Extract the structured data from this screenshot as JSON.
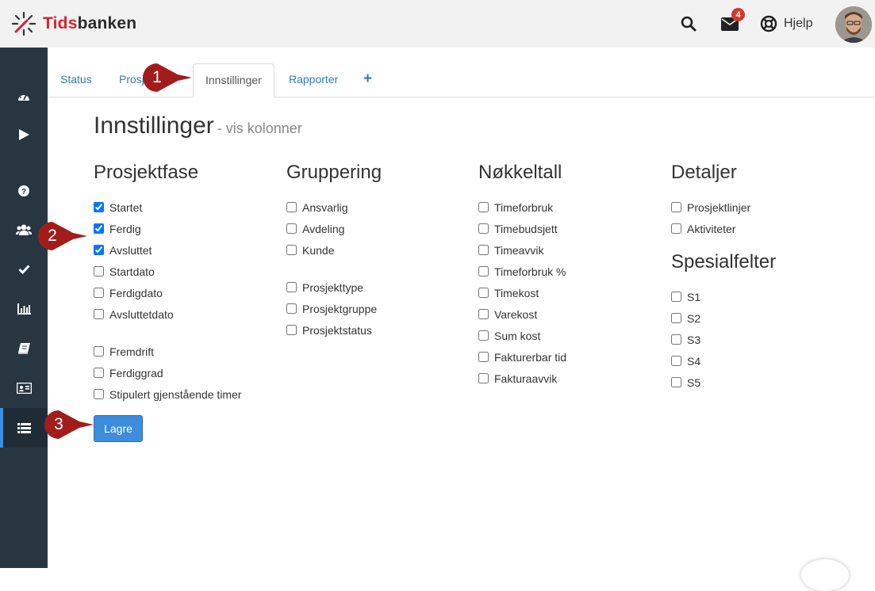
{
  "app": {
    "name_part1": "Tids",
    "name_part2": "banken"
  },
  "header": {
    "mail_badge": "4",
    "help_label": "Hjelp"
  },
  "sidebar": {
    "items": [
      {
        "icon": "dashboard-icon"
      },
      {
        "icon": "play-icon"
      },
      {
        "icon": "question-icon"
      },
      {
        "icon": "users-icon"
      },
      {
        "icon": "check-icon"
      },
      {
        "icon": "bar-chart-icon"
      },
      {
        "icon": "book-icon"
      },
      {
        "icon": "id-card-icon"
      },
      {
        "icon": "list-icon",
        "active": true
      }
    ]
  },
  "tabs": {
    "status": "Status",
    "prosjekter": "Prosjekter",
    "innstillinger": "Innstillinger",
    "rapporter": "Rapporter",
    "add": "+"
  },
  "page": {
    "title": "Innstillinger",
    "subtitle": "- vis kolonner"
  },
  "columns": {
    "prosjektfase": {
      "heading": "Prosjektfase",
      "group1": [
        {
          "label": "Startet",
          "checked": true
        },
        {
          "label": "Ferdig",
          "checked": true
        },
        {
          "label": "Avsluttet",
          "checked": true
        },
        {
          "label": "Startdato",
          "checked": false
        },
        {
          "label": "Ferdigdato",
          "checked": false
        },
        {
          "label": "Avsluttetdato",
          "checked": false
        }
      ],
      "group2": [
        {
          "label": "Fremdrift",
          "checked": false
        },
        {
          "label": "Ferdiggrad",
          "checked": false
        },
        {
          "label": "Stipulert gjenstående timer",
          "checked": false
        }
      ]
    },
    "gruppering": {
      "heading": "Gruppering",
      "group1": [
        {
          "label": "Ansvarlig",
          "checked": false
        },
        {
          "label": "Avdeling",
          "checked": false
        },
        {
          "label": "Kunde",
          "checked": false
        }
      ],
      "group2": [
        {
          "label": "Prosjekttype",
          "checked": false
        },
        {
          "label": "Prosjektgruppe",
          "checked": false
        },
        {
          "label": "Prosjektstatus",
          "checked": false
        }
      ]
    },
    "nokkeltall": {
      "heading": "Nøkkeltall",
      "items": [
        {
          "label": "Timeforbruk",
          "checked": false
        },
        {
          "label": "Timebudsjett",
          "checked": false
        },
        {
          "label": "Timeavvik",
          "checked": false
        },
        {
          "label": "Timeforbruk %",
          "checked": false
        },
        {
          "label": "Timekost",
          "checked": false
        },
        {
          "label": "Varekost",
          "checked": false
        },
        {
          "label": "Sum kost",
          "checked": false
        },
        {
          "label": "Fakturerbar tid",
          "checked": false
        },
        {
          "label": "Fakturaavvik",
          "checked": false
        }
      ]
    },
    "detaljer": {
      "heading": "Detaljer",
      "items": [
        {
          "label": "Prosjektlinjer",
          "checked": false
        },
        {
          "label": "Aktiviteter",
          "checked": false
        }
      ]
    },
    "spesialfelter": {
      "heading": "Spesialfelter",
      "items": [
        {
          "label": "S1",
          "checked": false
        },
        {
          "label": "S2",
          "checked": false
        },
        {
          "label": "S3",
          "checked": false
        },
        {
          "label": "S4",
          "checked": false
        },
        {
          "label": "S5",
          "checked": false
        }
      ]
    }
  },
  "save_button": "Lagre",
  "callouts": [
    "1",
    "2",
    "3"
  ],
  "colors": {
    "accent": "#3c8dde",
    "brand": "#d9232e",
    "sidebar": "#283641",
    "callout": "#a31c1c"
  }
}
